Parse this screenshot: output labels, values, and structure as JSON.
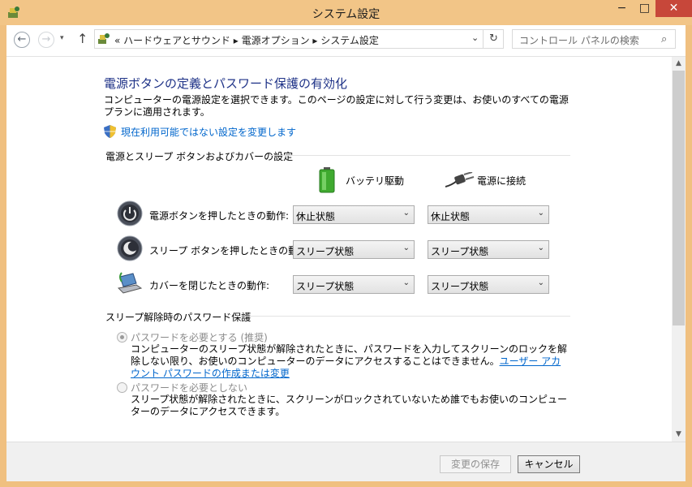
{
  "window": {
    "title": "システム設定",
    "controls": {
      "minimize": "−",
      "maximize": "□",
      "close": "✕"
    }
  },
  "addressbar": {
    "back": "←",
    "forward": "→",
    "recent": "▾",
    "up": "↑",
    "path": "« ハードウェアとサウンド ▸ 電源オプション ▸ システム設定",
    "dropdown": "⌄",
    "refresh": "↻"
  },
  "search": {
    "placeholder": "コントロール パネルの検索",
    "icon": "⌕"
  },
  "main": {
    "heading": "電源ボタンの定義とパスワード保護の有効化",
    "description": "コンピューターの電源設定を選択できます。このページの設定に対して行う変更は、お使いのすべての電源プランに適用されます。",
    "change_link": "現在利用可能ではない設定を変更します",
    "power_section": "電源とスリープ ボタンおよびカバーの設定",
    "col_battery": "バッテリ駆動",
    "col_plugged": "電源に接続",
    "rows": [
      {
        "label": "電源ボタンを押したときの動作:",
        "battery": "休止状態",
        "plugged": "休止状態"
      },
      {
        "label": "スリープ ボタンを押したときの動作:",
        "battery": "スリープ状態",
        "plugged": "スリープ状態"
      },
      {
        "label": "カバーを閉じたときの動作:",
        "battery": "スリープ状態",
        "plugged": "スリープ状態"
      }
    ],
    "password_section": "スリープ解除時のパスワード保護",
    "option_require": {
      "label": "パスワードを必要とする (推奨)",
      "desc": "コンピューターのスリープ状態が解除されたときに、パスワードを入力してスクリーンのロックを解除しない限り、お使いのコンピューターのデータにアクセスすることはできません。",
      "link": "ユーザー アカウント パスワードの作成または変更"
    },
    "option_none": {
      "label": "パスワードを必要としない",
      "desc": "スリープ状態が解除されたときに、スクリーンがロックされていないため誰でもお使いのコンピューターのデータにアクセスできます。"
    }
  },
  "scrollbar": {
    "up": "▲",
    "down": "▼"
  },
  "footer": {
    "save": "変更の保存",
    "cancel": "キャンセル"
  },
  "colors": {
    "heading": "#1e3287",
    "link": "#0066cc",
    "frame": "#f2c587",
    "close": "#c7473a"
  }
}
